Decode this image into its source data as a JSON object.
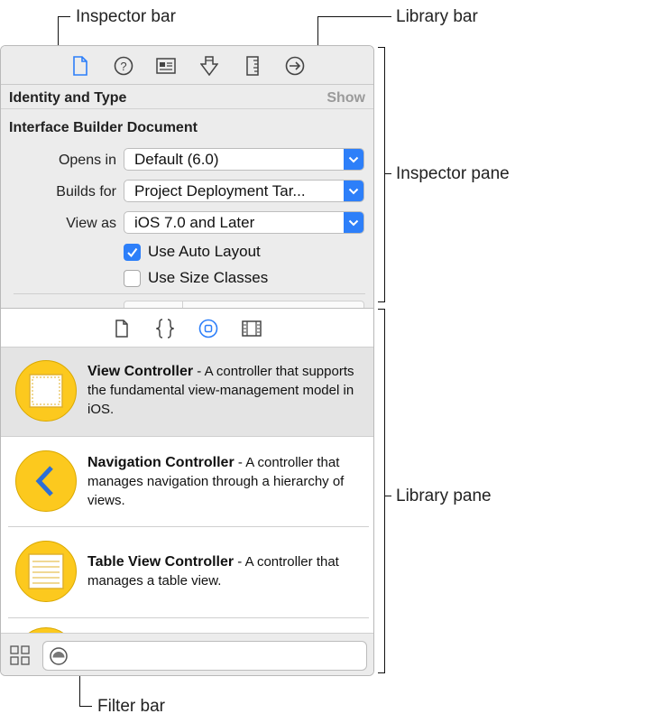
{
  "callouts": {
    "inspector_bar": "Inspector bar",
    "library_bar": "Library bar",
    "inspector_pane": "Inspector pane",
    "library_pane": "Library pane",
    "filter_bar": "Filter bar"
  },
  "inspector": {
    "bar_icons": [
      "file-inspector-icon",
      "quick-help-icon",
      "identity-inspector-icon",
      "attributes-inspector-icon",
      "size-inspector-icon",
      "connections-inspector-icon"
    ],
    "section_title": "Identity and Type",
    "show_link": "Show",
    "document_title": "Interface Builder Document",
    "fields": [
      {
        "label": "Opens in",
        "value": "Default (6.0)"
      },
      {
        "label": "Builds for",
        "value": "Project Deployment Tar..."
      },
      {
        "label": "View as",
        "value": "iOS 7.0 and Later"
      }
    ],
    "checkboxes": [
      {
        "label": "Use Auto Layout",
        "checked": true
      },
      {
        "label": "Use Size Classes",
        "checked": false
      }
    ]
  },
  "library": {
    "bar_icons": [
      "file-template-icon",
      "code-snippet-icon",
      "object-library-icon",
      "media-library-icon"
    ],
    "items": [
      {
        "title": "View Controller",
        "description": " - A controller that supports the fundamental view-management model in iOS.",
        "icon": "view-controller-icon",
        "selected": true
      },
      {
        "title": "Navigation Controller",
        "description": " - A controller that manages navigation through a hierarchy of views.",
        "icon": "navigation-controller-icon",
        "selected": false
      },
      {
        "title": "Table View Controller",
        "description": " - A controller that manages a table view.",
        "icon": "table-view-controller-icon",
        "selected": false
      }
    ]
  },
  "filter": {
    "placeholder": ""
  },
  "colors": {
    "accent": "#2d7ff9",
    "icon_yellow": "#fcc91e",
    "selected_row": "#e4e4e4"
  }
}
